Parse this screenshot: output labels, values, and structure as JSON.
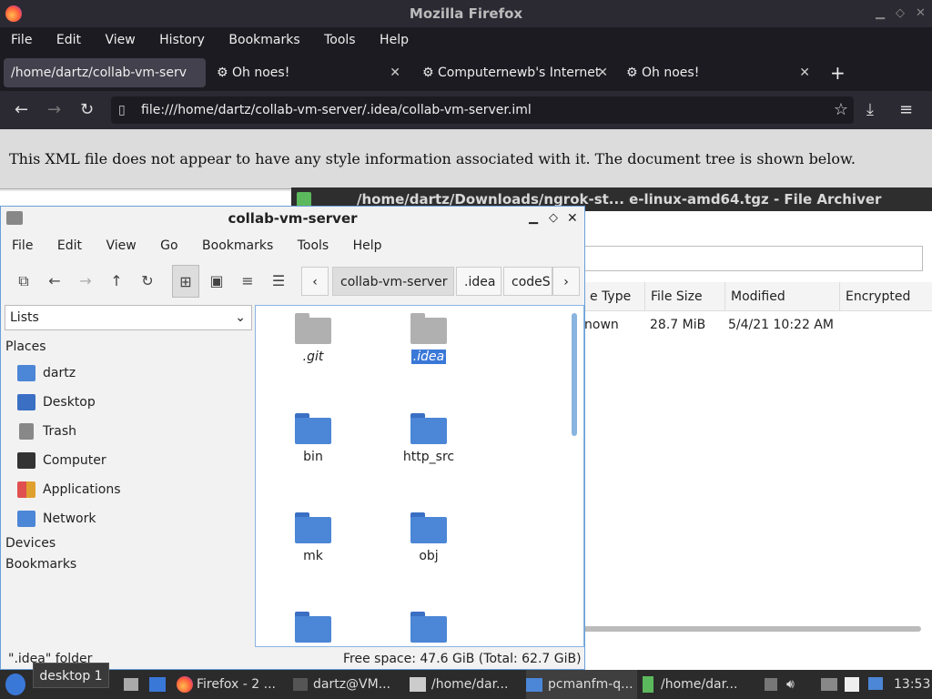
{
  "firefox": {
    "title": "Mozilla Firefox",
    "menu": [
      "File",
      "Edit",
      "View",
      "History",
      "Bookmarks",
      "Tools",
      "Help"
    ],
    "tabs": [
      {
        "label": "/home/dartz/collab-vm-serv",
        "active": true
      },
      {
        "label": "Oh noes!",
        "active": false
      },
      {
        "label": "Computernewb's Internet",
        "active": false
      },
      {
        "label": "Oh noes!",
        "active": false
      }
    ],
    "url": "file:///home/dartz/collab-vm-server/.idea/collab-vm-server.iml",
    "xml_message": "This XML file does not appear to have any style information associated with it. The document tree is shown below."
  },
  "archiver": {
    "title": "/home/dartz/Downloads/ngrok-st... e-linux-amd64.tgz - File Archiver",
    "columns": [
      "e Type",
      "File Size",
      "Modified",
      "Encrypted"
    ],
    "row": {
      "type": "nown",
      "size": "28.7 MiB",
      "modified": "5/4/21 10:22 AM"
    }
  },
  "filemanager": {
    "title": "collab-vm-server",
    "menu": [
      "File",
      "Edit",
      "View",
      "Go",
      "Bookmarks",
      "Tools",
      "Help"
    ],
    "breadcrumbs": [
      "collab-vm-server",
      ".idea",
      "codeS"
    ],
    "view_select": "Lists",
    "sidebar": {
      "places_label": "Places",
      "places": [
        {
          "label": "dartz",
          "icon": "home-folder-icon",
          "color": "#4c86d6"
        },
        {
          "label": "Desktop",
          "icon": "desktop-icon",
          "color": "#3a6fc4"
        },
        {
          "label": "Trash",
          "icon": "trash-icon",
          "color": "#888888"
        },
        {
          "label": "Computer",
          "icon": "computer-icon",
          "color": "#333333"
        },
        {
          "label": "Applications",
          "icon": "applications-icon",
          "color": "#e0a030"
        },
        {
          "label": "Network",
          "icon": "network-icon",
          "color": "#4c86d6"
        }
      ],
      "devices_label": "Devices",
      "bookmarks_label": "Bookmarks"
    },
    "files": [
      {
        "name": ".git",
        "color": "gray",
        "selected": false
      },
      {
        "name": ".idea",
        "color": "gray",
        "selected": true
      },
      {
        "name": "bin",
        "color": "blue",
        "selected": false
      },
      {
        "name": "http_src",
        "color": "blue",
        "selected": false
      },
      {
        "name": "mk",
        "color": "blue",
        "selected": false
      },
      {
        "name": "obj",
        "color": "blue",
        "selected": false
      },
      {
        "name": "",
        "color": "blue",
        "selected": false
      },
      {
        "name": "",
        "color": "blue",
        "selected": false
      }
    ],
    "status_left": "\".idea\" folder",
    "status_right": "Free space: 47.6 GiB (Total: 62.7 GiB)"
  },
  "taskbar": {
    "tooltip": "desktop 1",
    "items": [
      "Firefox - 2 ...",
      "dartz@VM...",
      "/home/dar...",
      "pcmanfm-q...",
      "/home/dar..."
    ],
    "clock": "13:53"
  }
}
